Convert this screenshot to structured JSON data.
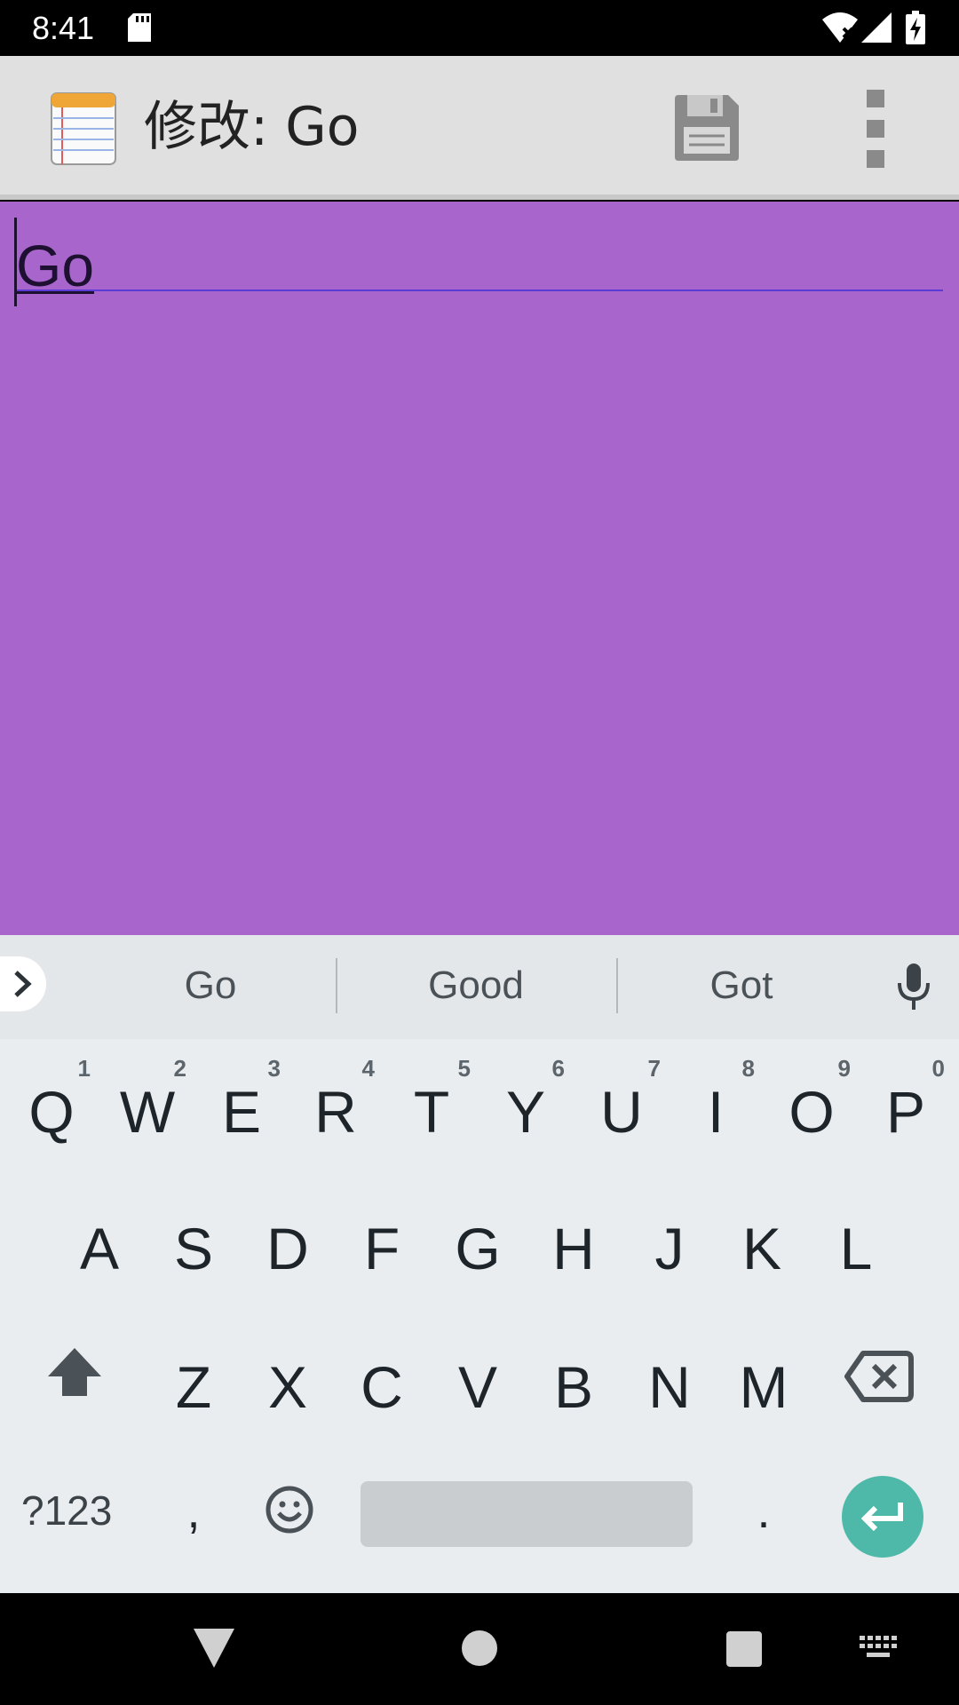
{
  "status_bar": {
    "time": "8:41",
    "icons": [
      "sd-card-icon",
      "wifi-off-icon",
      "signal-icon",
      "battery-charging-icon"
    ]
  },
  "app_bar": {
    "title": "修改: Go",
    "app_icon": "notepad-icon",
    "actions": [
      "save-icon",
      "more-vert-icon"
    ]
  },
  "editor": {
    "text": "Go",
    "background_color": "#a866cd"
  },
  "suggestions": {
    "items": [
      "Go",
      "Good",
      "Got"
    ],
    "expand_icon": "chevron-right-icon",
    "mic_icon": "microphone-icon"
  },
  "keyboard": {
    "row1": [
      {
        "key": "Q",
        "hint": "1"
      },
      {
        "key": "W",
        "hint": "2"
      },
      {
        "key": "E",
        "hint": "3"
      },
      {
        "key": "R",
        "hint": "4"
      },
      {
        "key": "T",
        "hint": "5"
      },
      {
        "key": "Y",
        "hint": "6"
      },
      {
        "key": "U",
        "hint": "7"
      },
      {
        "key": "I",
        "hint": "8"
      },
      {
        "key": "O",
        "hint": "9"
      },
      {
        "key": "P",
        "hint": "0"
      }
    ],
    "row2": [
      "A",
      "S",
      "D",
      "F",
      "G",
      "H",
      "J",
      "K",
      "L"
    ],
    "row3": [
      "Z",
      "X",
      "C",
      "V",
      "B",
      "N",
      "M"
    ],
    "symbols_label": "?123",
    "comma_label": ",",
    "period_label": ".",
    "accent_color": "#4fb9a9"
  },
  "nav_bar": {
    "icons": [
      "back-icon",
      "home-icon",
      "recents-icon",
      "keyboard-switch-icon"
    ]
  }
}
